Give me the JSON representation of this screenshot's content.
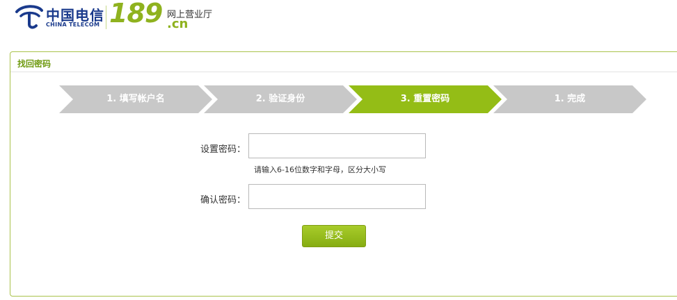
{
  "header": {
    "logo_cn": "中国电信",
    "logo_en": "CHINA TELECOM",
    "logo_189": "189",
    "logo_dotcn": ".cn",
    "logo_sub": "网上营业厅"
  },
  "panel": {
    "title": "找回密码"
  },
  "steps": [
    {
      "label": "1. 填写帐户名",
      "active": false
    },
    {
      "label": "2. 验证身份",
      "active": false
    },
    {
      "label": "3. 重置密码",
      "active": true
    },
    {
      "label": "1. 完成",
      "active": false
    }
  ],
  "form": {
    "password_label": "设置密码：",
    "password_value": "",
    "password_hint": "请输入6-16位数字和字母，区分大小写",
    "confirm_label": "确认密码：",
    "confirm_value": "",
    "submit_label": "提交"
  },
  "colors": {
    "accent": "#94bd16",
    "step_inactive": "#c8c8c8",
    "brand_blue": "#1a3a8c"
  }
}
